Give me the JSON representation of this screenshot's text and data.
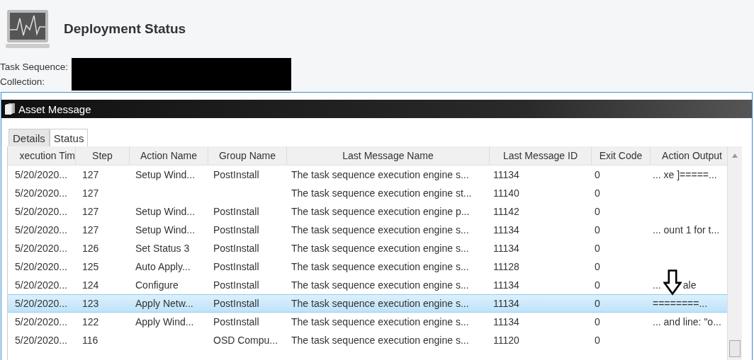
{
  "header": {
    "title": "Deployment Status"
  },
  "fields": [
    {
      "label": "Task Sequence:"
    },
    {
      "label": "Collection:"
    }
  ],
  "panel": {
    "title": "Asset Message"
  },
  "tabs": [
    {
      "label": "Details",
      "selected": false
    },
    {
      "label": "Status",
      "selected": true
    }
  ],
  "table": {
    "columns": [
      "xecution Tim",
      "Step",
      "Action Name",
      "Group Name",
      "Last Message Name",
      "Last Message ID",
      "Exit Code",
      "Action Output"
    ],
    "rows": [
      {
        "cells": [
          "5/20/2020...",
          "127",
          "Setup Wind...",
          "PostInstall",
          "The task sequence execution engine s...",
          "11134",
          "0",
          "... xe ]=====..."
        ],
        "selected": false
      },
      {
        "cells": [
          "5/20/2020...",
          "127",
          "",
          "",
          "The task sequence execution engine st...",
          "11140",
          "0",
          ""
        ],
        "selected": false
      },
      {
        "cells": [
          "5/20/2020...",
          "127",
          "Setup Wind...",
          "PostInstall",
          "The task sequence execution engine p...",
          "11142",
          "0",
          ""
        ],
        "selected": false
      },
      {
        "cells": [
          "5/20/2020...",
          "127",
          "Setup Wind...",
          "PostInstall",
          "The task sequence execution engine s...",
          "11134",
          "0",
          "... ount 1 for t..."
        ],
        "selected": false
      },
      {
        "cells": [
          "5/20/2020...",
          "126",
          "Set Status 3",
          "PostInstall",
          "The task sequence execution engine s...",
          "11134",
          "0",
          ""
        ],
        "selected": false
      },
      {
        "cells": [
          "5/20/2020...",
          "125",
          "Auto Apply...",
          "PostInstall",
          "The task sequence execution engine s...",
          "11128",
          "0",
          ""
        ],
        "selected": false
      },
      {
        "cells": [
          "5/20/2020...",
          "124",
          "Configure",
          "PostInstall",
          "The task sequence execution engine s...",
          "11134",
          "0",
          "...        ale"
        ],
        "selected": false
      },
      {
        "cells": [
          "5/20/2020...",
          "123",
          "Apply Netw...",
          "PostInstall",
          "The task sequence execution engine s...",
          "11134",
          "0",
          "========..."
        ],
        "selected": true
      },
      {
        "cells": [
          "5/20/2020...",
          "122",
          "Apply Wind...",
          "PostInstall",
          "The task sequence execution engine s...",
          "11134",
          "0",
          "... and line: \"o..."
        ],
        "selected": false
      },
      {
        "cells": [
          "5/20/2020...",
          "116",
          "",
          "OSD Compu...",
          "The task sequence execution engine s...",
          "11120",
          "0",
          ""
        ],
        "selected": false
      }
    ]
  }
}
